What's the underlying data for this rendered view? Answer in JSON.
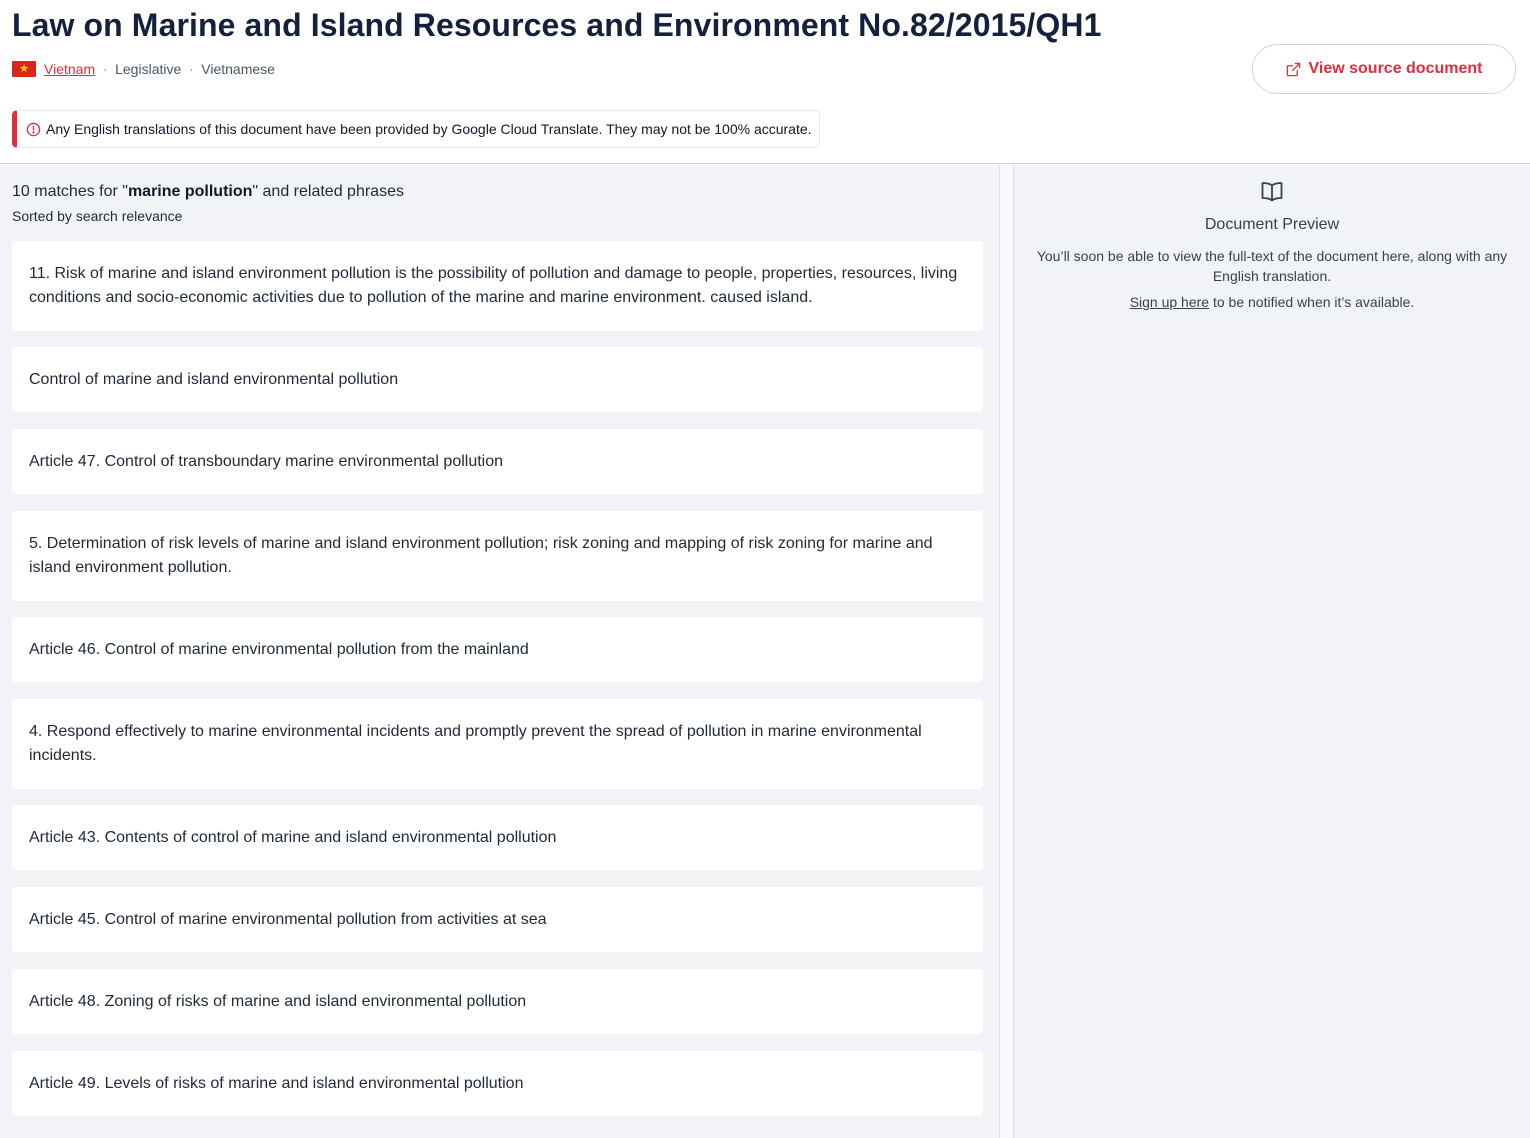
{
  "document": {
    "title": "Law on Marine and Island Resources and Environment No.82/2015/QH1",
    "country": "Vietnam",
    "type": "Legislative",
    "language": "Vietnamese",
    "source_button": "View source document"
  },
  "notice": {
    "text": "Any English translations of this document have been provided by Google Cloud Translate. They may not be 100% accurate."
  },
  "results": {
    "count_prefix": "10 matches for \"",
    "query": "marine pollution",
    "count_suffix": "\" and related phrases",
    "sorted_label": "Sorted by search relevance",
    "items": [
      "11. Risk of marine and island environment pollution is the possibility of pollution and damage to people, properties, resources, living conditions and socio-economic activities due to pollution of the marine and marine environment. caused island.",
      "Control of marine and island environmental pollution",
      "Article 47. Control of transboundary marine environmental pollution",
      "5. Determination of risk levels of marine and island environment pollution; risk zoning and mapping of risk zoning for marine and island environment pollution.",
      "Article 46. Control of marine environmental pollution from the mainland",
      "4. Respond effectively to marine environmental incidents and promptly prevent the spread of pollution in marine environmental incidents.",
      "Article 43. Contents of control of marine and island environmental pollution",
      "Article 45. Control of marine environmental pollution from activities at sea",
      "Article 48. Zoning of risks of marine and island environmental pollution",
      "Article 49. Levels of risks of marine and island environmental pollution"
    ]
  },
  "preview": {
    "title": "Document Preview",
    "text": "You’ll soon be able to view the full-text of the document here, along with any English translation.",
    "signup_link": "Sign up here",
    "signup_suffix": " to be notified when it’s available."
  },
  "colors": {
    "accent": "#e02e3d",
    "title": "#14213d",
    "panel_bg": "#f2f3f6"
  }
}
